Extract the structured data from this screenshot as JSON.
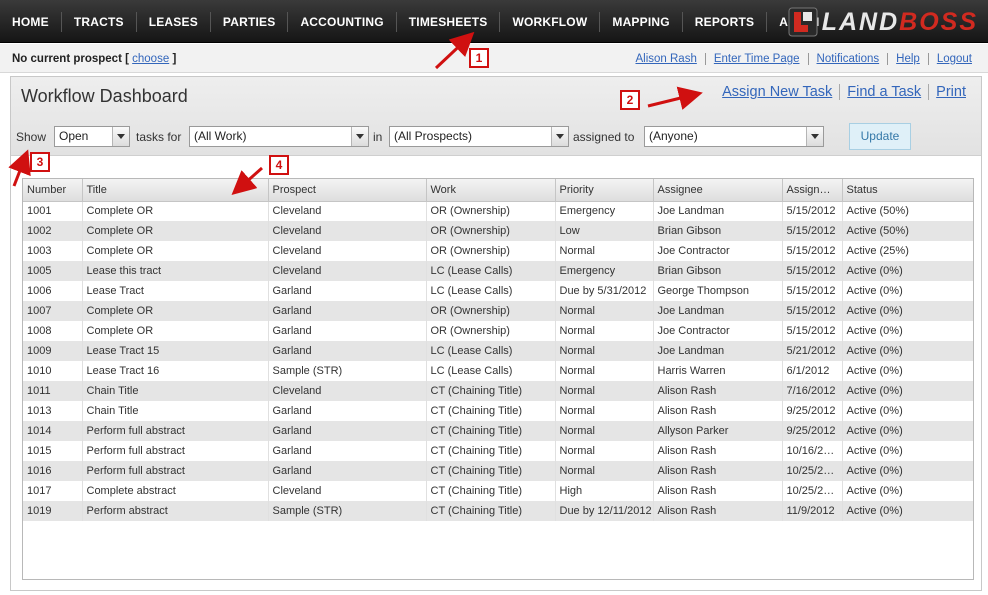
{
  "nav": {
    "items": [
      "HOME",
      "TRACTS",
      "LEASES",
      "PARTIES",
      "ACCOUNTING",
      "TIMESHEETS",
      "WORKFLOW",
      "MAPPING",
      "REPORTS",
      "ADMIN"
    ],
    "logo_land": "LAND",
    "logo_boss": "BOSS"
  },
  "subheader": {
    "prospect_text": "No current prospect [",
    "choose_link": "choose",
    "prospect_close": "]",
    "links": [
      "Alison Rash",
      "Enter Time Page",
      "Notifications",
      "Help",
      "Logout"
    ]
  },
  "dashboard": {
    "title": "Workflow Dashboard",
    "actions": [
      "Assign New Task",
      "Find a Task",
      "Print"
    ]
  },
  "filters": {
    "show_label": "Show",
    "show_value": "Open",
    "tasks_for_label": "tasks for",
    "tasks_for_value": "(All Work)",
    "in_label": "in",
    "in_value": "(All Prospects)",
    "assigned_to_label": "assigned to",
    "assigned_to_value": "(Anyone)",
    "update_label": "Update"
  },
  "table": {
    "columns": [
      "Number",
      "Title",
      "Prospect",
      "Work",
      "Priority",
      "Assignee",
      "Assign…",
      "Status"
    ],
    "rows": [
      [
        "1001",
        "Complete OR",
        "Cleveland",
        "OR (Ownership)",
        "Emergency",
        "Joe Landman",
        "5/15/2012",
        "Active (50%)"
      ],
      [
        "1002",
        "Complete OR",
        "Cleveland",
        "OR (Ownership)",
        "Low",
        "Brian Gibson",
        "5/15/2012",
        "Active (50%)"
      ],
      [
        "1003",
        "Complete OR",
        "Cleveland",
        "OR (Ownership)",
        "Normal",
        "Joe Contractor",
        "5/15/2012",
        "Active (25%)"
      ],
      [
        "1005",
        "Lease this tract",
        "Cleveland",
        "LC (Lease Calls)",
        "Emergency",
        "Brian Gibson",
        "5/15/2012",
        "Active (0%)"
      ],
      [
        "1006",
        "Lease Tract",
        "Garland",
        "LC (Lease Calls)",
        "Due by 5/31/2012",
        "George Thompson",
        "5/15/2012",
        "Active (0%)"
      ],
      [
        "1007",
        "Complete OR",
        "Garland",
        "OR (Ownership)",
        "Normal",
        "Joe Landman",
        "5/15/2012",
        "Active (0%)"
      ],
      [
        "1008",
        "Complete OR",
        "Garland",
        "OR (Ownership)",
        "Normal",
        "Joe Contractor",
        "5/15/2012",
        "Active (0%)"
      ],
      [
        "1009",
        "Lease Tract 15",
        "Garland",
        "LC (Lease Calls)",
        "Normal",
        "Joe Landman",
        "5/21/2012",
        "Active (0%)"
      ],
      [
        "1010",
        "Lease Tract 16",
        "Sample (STR)",
        "LC (Lease Calls)",
        "Normal",
        "Harris Warren",
        "6/1/2012",
        "Active (0%)"
      ],
      [
        "1011",
        "Chain Title",
        "Cleveland",
        "CT (Chaining Title)",
        "Normal",
        "Alison Rash",
        "7/16/2012",
        "Active (0%)"
      ],
      [
        "1013",
        "Chain Title",
        "Garland",
        "CT (Chaining Title)",
        "Normal",
        "Alison Rash",
        "9/25/2012",
        "Active (0%)"
      ],
      [
        "1014",
        "Perform full abstract",
        "Garland",
        "CT (Chaining Title)",
        "Normal",
        "Allyson Parker",
        "9/25/2012",
        "Active (0%)"
      ],
      [
        "1015",
        "Perform full abstract",
        "Garland",
        "CT (Chaining Title)",
        "Normal",
        "Alison Rash",
        "10/16/2…",
        "Active (0%)"
      ],
      [
        "1016",
        "Perform full abstract",
        "Garland",
        "CT (Chaining Title)",
        "Normal",
        "Alison Rash",
        "10/25/2…",
        "Active (0%)"
      ],
      [
        "1017",
        "Complete abstract",
        "Cleveland",
        "CT (Chaining Title)",
        "High",
        "Alison Rash",
        "10/25/2…",
        "Active (0%)"
      ],
      [
        "1019",
        "Perform abstract",
        "Sample (STR)",
        "CT (Chaining Title)",
        "Due by 12/11/2012",
        "Alison Rash",
        "11/9/2012",
        "Active (0%)"
      ]
    ]
  },
  "callouts": [
    "1",
    "2",
    "3",
    "4"
  ],
  "colors": {
    "link": "#3366bb",
    "annotation": "#d01010",
    "logo_red": "#d12a20"
  }
}
